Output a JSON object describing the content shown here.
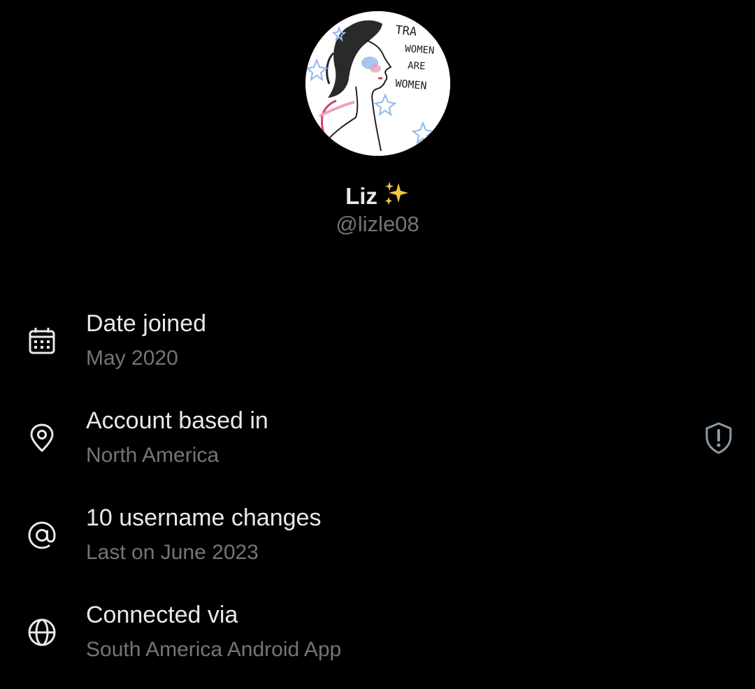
{
  "profile": {
    "display_name": "Liz",
    "name_emoji": "✨",
    "handle": "@lizle08",
    "avatar": {
      "icon": "avatar-illustration",
      "artwork_text": [
        "TRA",
        "WOMEN",
        "ARE",
        "WOMEN"
      ]
    }
  },
  "info_rows": [
    {
      "icon": "calendar-icon",
      "title": "Date joined",
      "subtitle": "May 2020"
    },
    {
      "icon": "location-pin-icon",
      "title": "Account based in",
      "subtitle": "North America",
      "trailing_icon": "shield-alert-icon"
    },
    {
      "icon": "at-sign-icon",
      "title": "10 username changes",
      "subtitle": "Last on June 2023"
    },
    {
      "icon": "globe-icon",
      "title": "Connected via",
      "subtitle": "South America Android App"
    }
  ],
  "colors": {
    "background": "#000000",
    "primary_text": "#e7e9ea",
    "secondary_text": "#71767b",
    "sparkle": "#f4c542"
  }
}
